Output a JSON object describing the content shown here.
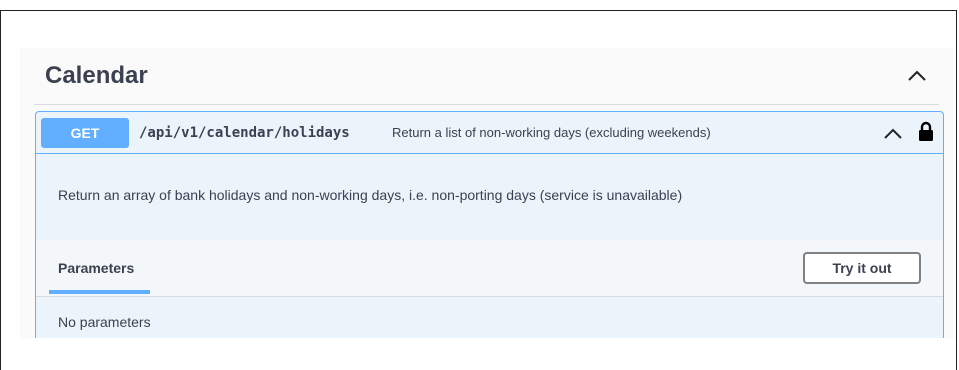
{
  "section": {
    "title": "Calendar"
  },
  "operation": {
    "method": "GET",
    "path": "/api/v1/calendar/holidays",
    "summary": "Return a list of non-working days (excluding weekends)",
    "description": "Return an array of bank holidays and non-working days, i.e. non-porting days (service is unavailable)"
  },
  "parameters": {
    "tab_label": "Parameters",
    "try_button_label": "Try it out",
    "empty_text": "No parameters"
  },
  "icons": {
    "section_toggle": "chevron-up-icon",
    "operation_toggle": "chevron-up-icon",
    "authorization": "lock-icon"
  },
  "colors": {
    "get_method": "#61affe",
    "opblock_background": "#ebf3fb"
  }
}
